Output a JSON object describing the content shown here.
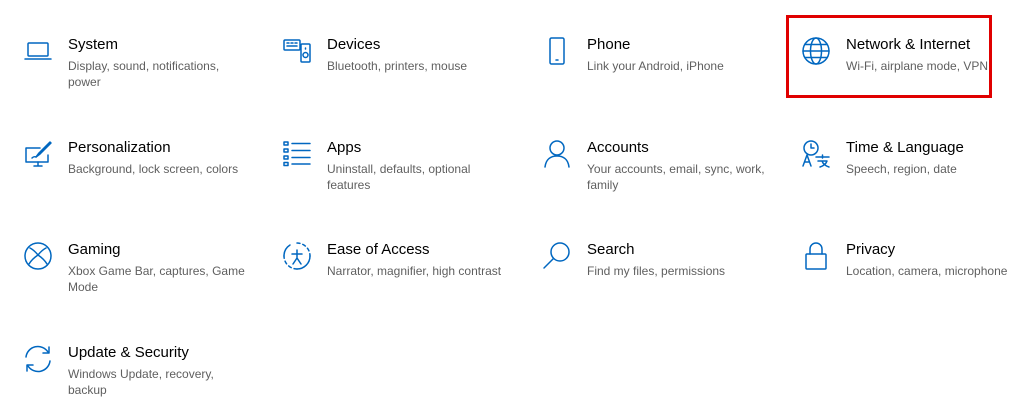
{
  "colors": {
    "accent": "#0067c0",
    "highlight": "#e00000"
  },
  "tiles": [
    {
      "name": "System",
      "desc": "Display, sound, notifications, power",
      "icon": "laptop-icon"
    },
    {
      "name": "Devices",
      "desc": "Bluetooth, printers, mouse",
      "icon": "devices-icon"
    },
    {
      "name": "Phone",
      "desc": "Link your Android, iPhone",
      "icon": "phone-icon"
    },
    {
      "name": "Network & Internet",
      "desc": "Wi-Fi, airplane mode, VPN",
      "icon": "globe-icon"
    },
    {
      "name": "Personalization",
      "desc": "Background, lock screen, colors",
      "icon": "paint-icon"
    },
    {
      "name": "Apps",
      "desc": "Uninstall, defaults, optional features",
      "icon": "apps-list-icon"
    },
    {
      "name": "Accounts",
      "desc": "Your accounts, email, sync, work, family",
      "icon": "person-icon"
    },
    {
      "name": "Time & Language",
      "desc": "Speech, region, date",
      "icon": "time-language-icon"
    },
    {
      "name": "Gaming",
      "desc": "Xbox Game Bar, captures, Game Mode",
      "icon": "xbox-icon"
    },
    {
      "name": "Ease of Access",
      "desc": "Narrator, magnifier, high contrast",
      "icon": "ease-of-access-icon"
    },
    {
      "name": "Search",
      "desc": "Find my files, permissions",
      "icon": "search-icon"
    },
    {
      "name": "Privacy",
      "desc": "Location, camera, microphone",
      "icon": "lock-icon"
    },
    {
      "name": "Update & Security",
      "desc": "Windows Update, recovery, backup",
      "icon": "sync-icon"
    }
  ]
}
